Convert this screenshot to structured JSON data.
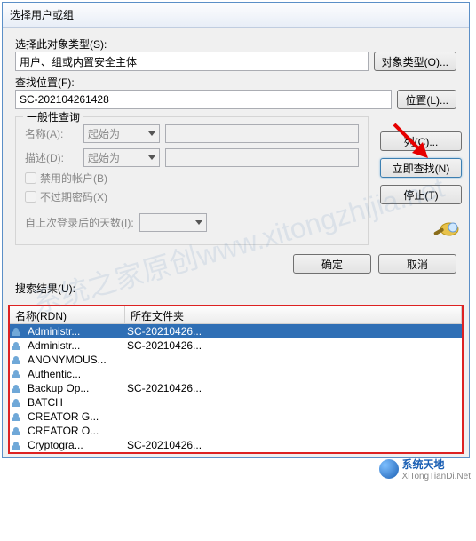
{
  "window": {
    "title": "选择用户或组"
  },
  "object_type": {
    "label": "选择此对象类型(S):",
    "value": "用户、组或内置安全主体",
    "button": "对象类型(O)..."
  },
  "location": {
    "label": "查找位置(F):",
    "value": "SC-202104261428",
    "button": "位置(L)..."
  },
  "query": {
    "legend": "一般性查询",
    "name_label": "名称(A):",
    "name_op": "起始为",
    "desc_label": "描述(D):",
    "desc_op": "起始为",
    "disabled_label": "禁用的帐户(B)",
    "noexpire_label": "不过期密码(X)",
    "days_label": "自上次登录后的天数(I):"
  },
  "buttons": {
    "columns": "列(C)...",
    "find_now": "立即查找(N)",
    "stop": "停止(T)",
    "ok": "确定",
    "cancel": "取消"
  },
  "results": {
    "label": "搜索结果(U):",
    "col1": "名称(RDN)",
    "col2": "所在文件夹",
    "rows": [
      {
        "name": "Administr...",
        "folder": "SC-20210426...",
        "selected": true
      },
      {
        "name": "Administr...",
        "folder": "SC-20210426..."
      },
      {
        "name": "ANONYMOUS...",
        "folder": ""
      },
      {
        "name": "Authentic...",
        "folder": ""
      },
      {
        "name": "Backup Op...",
        "folder": "SC-20210426..."
      },
      {
        "name": "BATCH",
        "folder": ""
      },
      {
        "name": "CREATOR G...",
        "folder": ""
      },
      {
        "name": "CREATOR O...",
        "folder": ""
      },
      {
        "name": "Cryptogra...",
        "folder": "SC-20210426..."
      }
    ]
  },
  "watermark": "系统之家原创www.xitongzhijia.net",
  "brand": {
    "name": "系统天地",
    "url": "XiTongTianDi.Net"
  }
}
